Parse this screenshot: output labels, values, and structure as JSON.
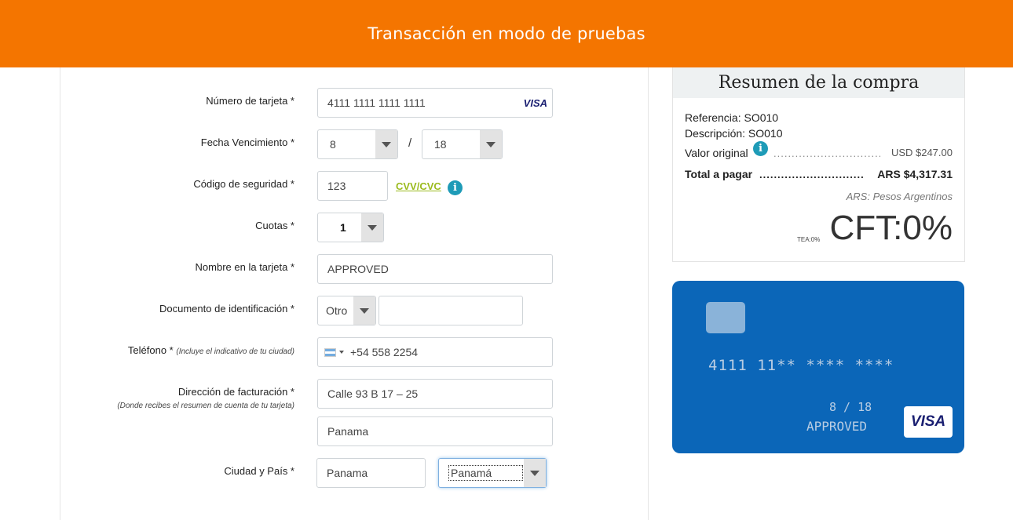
{
  "header": {
    "title": "Transacción en modo de pruebas"
  },
  "form": {
    "card_number": {
      "label": "Número de tarjeta *",
      "value": "4111 1111 1111 1111",
      "brand": "VISA"
    },
    "expiry": {
      "label": "Fecha Vencimiento *",
      "month": "8",
      "separator": "/",
      "year": "18"
    },
    "security_code": {
      "label": "Código de seguridad *",
      "value": "123",
      "link": "CVV/CVC",
      "info": "i"
    },
    "installments": {
      "label": "Cuotas *",
      "value": "1"
    },
    "card_name": {
      "label": "Nombre en la tarjeta *",
      "value": "APPROVED"
    },
    "document": {
      "label": "Documento de identificación *",
      "type": "Otro",
      "value": ""
    },
    "phone": {
      "label": "Teléfono *",
      "hint": "(Incluye el indicativo de tu ciudad)",
      "value": "+54 558 2254",
      "flag": "argentina-flag-icon"
    },
    "address": {
      "label": "Dirección de facturación *",
      "hint": "(Donde recibes el resumen de cuenta de tu tarjeta)",
      "line1": "Calle 93 B 17 – 25",
      "line2": "Panama"
    },
    "city_country": {
      "label": "Ciudad y País *",
      "city": "Panama",
      "country": "Panamá"
    }
  },
  "summary": {
    "title": "Resumen de la compra",
    "reference_label": "Referencia:",
    "reference": "SO010",
    "description_label": "Descripción:",
    "description": "SO010",
    "original_label": "Valor original",
    "original_value": "USD $247.00",
    "total_label": "Total a pagar",
    "total_value": "ARS $4,317.31",
    "currency_note": "ARS: Pesos Argentinos",
    "tea": "TEA:0%",
    "cft": "CFT:0%"
  },
  "card_preview": {
    "number": "4111 11** **** ****",
    "expiry": "8 / 18",
    "name": "APPROVED",
    "brand": "VISA"
  },
  "colors": {
    "header": "#f47500",
    "card": "#0b66b8",
    "info": "#1e9bb7",
    "link": "#9bbb1e"
  }
}
